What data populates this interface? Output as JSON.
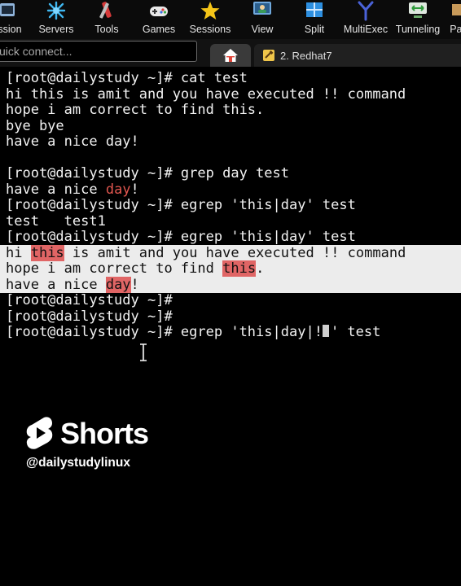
{
  "toolbar": {
    "items": [
      {
        "label": "ssion",
        "icon": "session-icon"
      },
      {
        "label": "Servers",
        "icon": "servers-icon"
      },
      {
        "label": "Tools",
        "icon": "tools-icon"
      },
      {
        "label": "Games",
        "icon": "gamepad-icon"
      },
      {
        "label": "Sessions",
        "icon": "star-icon"
      },
      {
        "label": "View",
        "icon": "view-icon"
      },
      {
        "label": "Split",
        "icon": "split-icon"
      },
      {
        "label": "MultiExec",
        "icon": "multiexec-icon"
      },
      {
        "label": "Tunneling",
        "icon": "tunneling-icon"
      },
      {
        "label": "Pac",
        "icon": "packages-icon"
      }
    ]
  },
  "quick_connect": {
    "placeholder": "uick connect..."
  },
  "tabs": {
    "session_tab_label": "2. Redhat7"
  },
  "terminal": {
    "lines": [
      {
        "text": "[root@dailystudy ~]# cat test"
      },
      {
        "text": "hi this is amit and you have executed !! command"
      },
      {
        "text": "hope i am correct to find this."
      },
      {
        "text": "bye bye"
      },
      {
        "text": "have a nice day!"
      },
      {
        "text": ""
      },
      {
        "text": "[root@dailystudy ~]# grep day test"
      },
      {
        "parts": [
          "have a nice ",
          "day",
          "!"
        ]
      },
      {
        "text": "[root@dailystudy ~]# egrep 'this|day' test"
      },
      {
        "text": "test   test1"
      },
      {
        "text": "[root@dailystudy ~]# egrep 'this|day' test"
      },
      {
        "parts": [
          "hi ",
          "this",
          " is amit and you have executed !! command"
        ]
      },
      {
        "parts": [
          "hope i am correct to find ",
          "this",
          "."
        ]
      },
      {
        "parts": [
          "have a nice ",
          "day",
          "!"
        ]
      },
      {
        "text": "[root@dailystudy ~]#"
      },
      {
        "text": "[root@dailystudy ~]#"
      },
      {
        "parts": [
          "[root@dailystudy ~]# egrep 'this|day|!",
          "' test"
        ]
      }
    ]
  },
  "overlay": {
    "brand": "Shorts",
    "handle": "@dailystudylinux"
  },
  "colors": {
    "terminal_bg": "#000000",
    "terminal_fg": "#f2f2f2",
    "match_red": "#e0564f",
    "selection_bg": "#ececec"
  }
}
